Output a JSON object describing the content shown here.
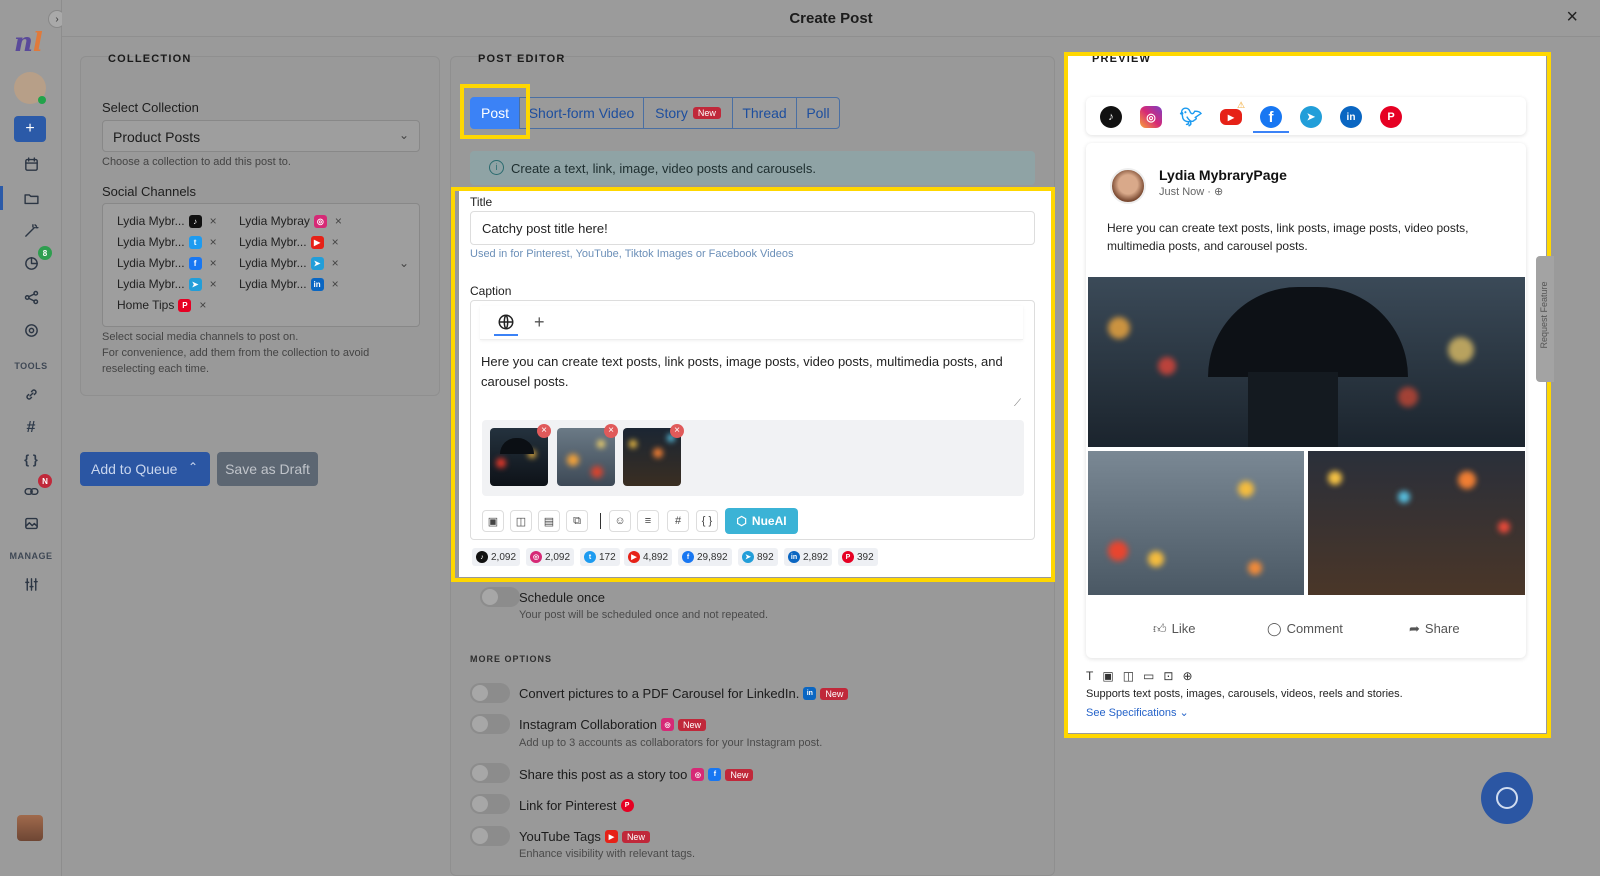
{
  "header": {
    "title": "Create Post",
    "close": "×"
  },
  "sidebar": {
    "tools_label": "TOOLS",
    "manage_label": "MANAGE",
    "badge_analytics": "8",
    "badge_links": "N"
  },
  "collection": {
    "title": "COLLECTION",
    "select_label": "Select Collection",
    "select_value": "Product Posts",
    "select_hint": "Choose a collection to add this post to.",
    "channels_label": "Social Channels",
    "channels": [
      {
        "name": "Lydia Mybr...",
        "icon": "tiktok-icon",
        "color": "#111111",
        "glyph": "♪"
      },
      {
        "name": "Lydia Mybray",
        "icon": "instagram-icon",
        "color": "#d62976",
        "glyph": "◎"
      },
      {
        "name": "Lydia Mybr...",
        "icon": "twitter-icon",
        "color": "#1d9bf0",
        "glyph": "t"
      },
      {
        "name": "Lydia Mybr...",
        "icon": "youtube-icon",
        "color": "#e62117",
        "glyph": "▶"
      },
      {
        "name": "Lydia Mybr...",
        "icon": "facebook-icon",
        "color": "#1877f2",
        "glyph": "f"
      },
      {
        "name": "Lydia Mybr...",
        "icon": "telegram-icon",
        "color": "#229ed9",
        "glyph": "➤"
      },
      {
        "name": "Lydia Mybr...",
        "icon": "telegram-icon",
        "color": "#229ed9",
        "glyph": "➤"
      },
      {
        "name": "Lydia Mybr...",
        "icon": "linkedin-icon",
        "color": "#0a66c2",
        "glyph": "in"
      },
      {
        "name": "Home Tips",
        "icon": "pinterest-icon",
        "color": "#e60023",
        "glyph": "P"
      }
    ],
    "channels_hint": "Select social media channels to post on.",
    "channels_hint2": "For convenience, add them from the collection to avoid reselecting each time.",
    "add_queue": "Add to Queue",
    "save_draft": "Save as Draft"
  },
  "editor": {
    "title": "POST EDITOR",
    "tabs": [
      "Post",
      "Short-form Video",
      "Story",
      "Thread",
      "Poll"
    ],
    "story_badge": "New",
    "info": "Create a text, link, image, video posts and carousels.",
    "title_label": "Title",
    "title_value": "Catchy post title here!",
    "title_hint": "Used in for Pinterest, YouTube, Tiktok Images or Facebook Videos",
    "caption_label": "Caption",
    "caption_text": "Here you can create text posts, link posts, image posts, video posts, multimedia posts, and carousel posts.",
    "nueai": "NueAI",
    "counts": [
      {
        "icon": "tiktok-icon",
        "value": "2,092",
        "color": "#111111",
        "glyph": "♪"
      },
      {
        "icon": "instagram-icon",
        "value": "2,092",
        "color": "#d62976",
        "glyph": "◎"
      },
      {
        "icon": "twitter-icon",
        "value": "172",
        "color": "#1d9bf0",
        "glyph": "t"
      },
      {
        "icon": "youtube-icon",
        "value": "4,892",
        "color": "#e62117",
        "glyph": "▶"
      },
      {
        "icon": "facebook-icon",
        "value": "29,892",
        "color": "#1877f2",
        "glyph": "f"
      },
      {
        "icon": "telegram-icon",
        "value": "892",
        "color": "#229ed9",
        "glyph": "➤"
      },
      {
        "icon": "linkedin-icon",
        "value": "2,892",
        "color": "#0a66c2",
        "glyph": "in"
      },
      {
        "icon": "pinterest-icon",
        "value": "392",
        "color": "#e60023",
        "glyph": "P"
      }
    ],
    "schedule_title": "Schedule once",
    "schedule_hint": "Your post will be scheduled once and not repeated.",
    "more_options": "MORE OPTIONS",
    "options": [
      {
        "label": "Convert pictures to a PDF Carousel for LinkedIn.",
        "badge": "New"
      },
      {
        "label": "Instagram Collaboration",
        "badge": "New",
        "hint": "Add up to 3 accounts as collaborators for your Instagram post."
      },
      {
        "label": "Share this post as a story too",
        "badge": "New"
      },
      {
        "label": "Link for Pinterest"
      },
      {
        "label": "YouTube Tags",
        "badge": "New",
        "hint": "Enhance visibility with relevant tags."
      }
    ]
  },
  "preview": {
    "title": "PREVIEW",
    "page_name": "Lydia MybraryPage",
    "time": "Just Now ·",
    "text": "Here you can create text posts, link posts, image posts, video posts, multimedia posts, and carousel posts.",
    "like": "Like",
    "comment": "Comment",
    "share": "Share",
    "supports": "Supports text posts, images, carousels, videos, reels and stories.",
    "specs": "See Specifications",
    "request_feature": "Request Feature"
  },
  "colors": {
    "accent": "#3b82f6",
    "highlight": "#ffd700",
    "nueai": "#3bb3d6"
  }
}
